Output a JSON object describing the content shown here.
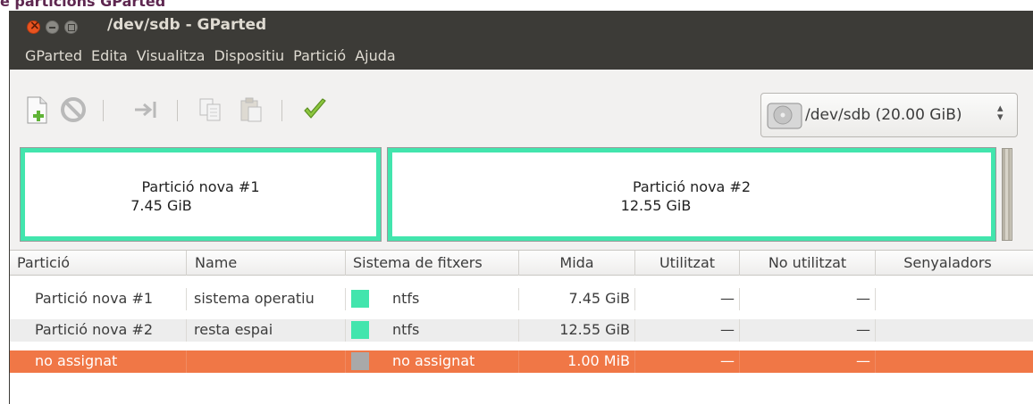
{
  "background_window_title": "e particions GParted",
  "window": {
    "title": "/dev/sdb - GParted"
  },
  "menu": [
    "GParted",
    "Edita",
    "Visualitza",
    "Dispositiu",
    "Partició",
    "Ajuda"
  ],
  "toolbar": {
    "icons": [
      "new-partition-icon",
      "delete-icon",
      "resize-move-icon",
      "copy-icon",
      "paste-icon",
      "apply-icon"
    ]
  },
  "device": {
    "label": "/dev/sdb  (20.00 GiB)",
    "icon": "hard-disk-icon"
  },
  "disk_map": [
    {
      "name": "Partició nova #1",
      "size": "7.45 GiB"
    },
    {
      "name": "Partició nova #2",
      "size": "12.55 GiB"
    }
  ],
  "table": {
    "columns": [
      "Partició",
      "Name",
      "Sistema de fitxers",
      "Mida",
      "Utilitzat",
      "No utilitzat",
      "Senyaladors"
    ],
    "rows": [
      {
        "partition": "Partició nova #1",
        "name": "sistema operatiu",
        "fs_color": "#42e5ad",
        "fs": "ntfs",
        "size": "7.45 GiB",
        "used": "—",
        "unused": "—",
        "flags": ""
      },
      {
        "partition": "Partició nova #2",
        "name": "resta espai",
        "fs_color": "#42e5ad",
        "fs": "ntfs",
        "size": "12.55 GiB",
        "used": "—",
        "unused": "—",
        "flags": ""
      },
      {
        "partition": "no assignat",
        "name": "",
        "fs_color": "#a9a9a9",
        "fs": "no assignat",
        "size": "1.00 MiB",
        "used": "—",
        "unused": "—",
        "flags": ""
      }
    ],
    "selected_row_index": 2
  },
  "colors": {
    "titlebar": "#3c3b37",
    "selection": "#f07746",
    "ntfs": "#42e5ad",
    "unallocated": "#a9a9a9"
  }
}
